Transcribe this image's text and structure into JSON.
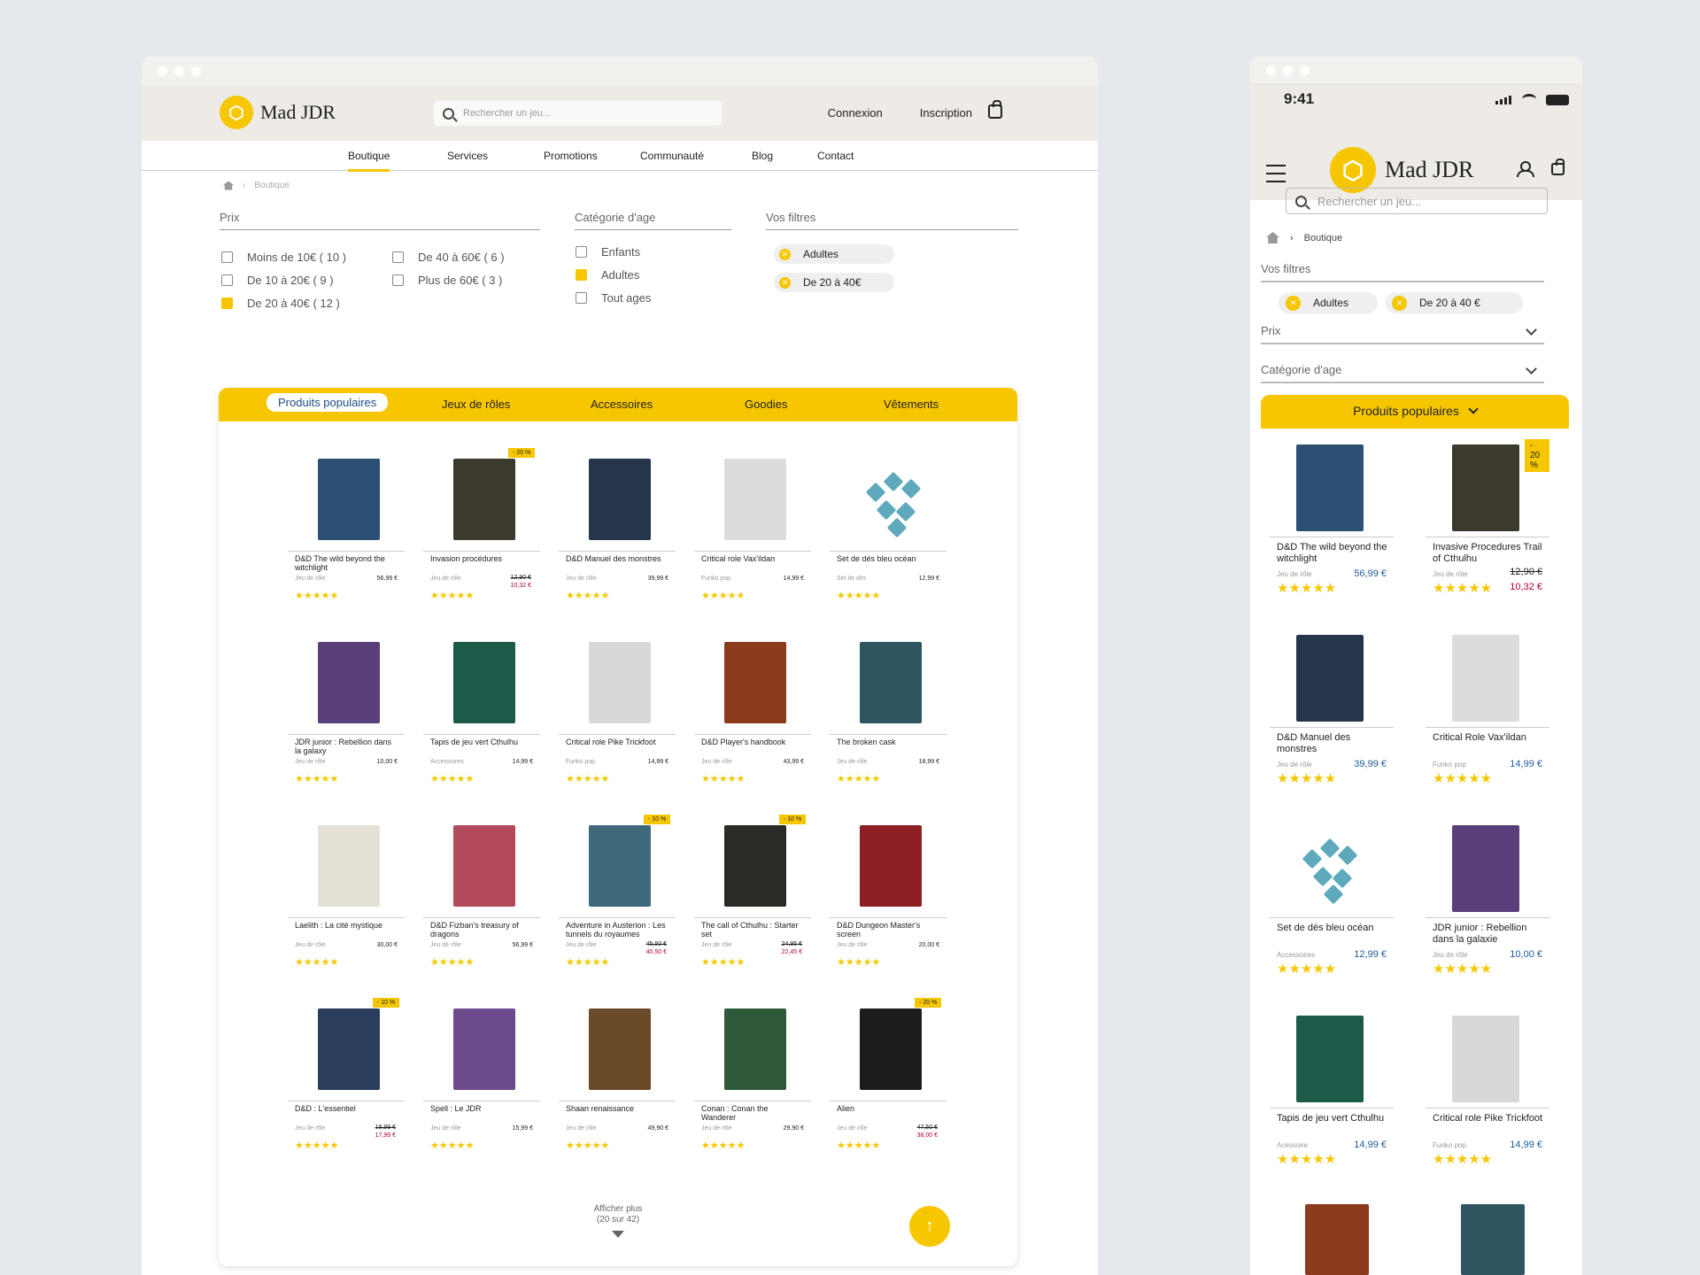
{
  "brand": {
    "name": "Mad JDR",
    "accent": "#f6c700",
    "price_color": "#1f5a9a",
    "sale_color": "#b0002a"
  },
  "desktop": {
    "search_placeholder": "Rechercher un jeu...",
    "login": "Connexion",
    "signup": "Inscription",
    "nav": [
      "Boutique",
      "Services",
      "Promotions",
      "Communauté",
      "Blog",
      "Contact"
    ],
    "breadcrumb": "Boutique",
    "filters": {
      "price_title": "Prix",
      "price_options": [
        "Moins de 10€ ( 10 )",
        "De 10 à 20€ ( 9 )",
        "De 20 à 40€ ( 12 )",
        "De 40 à 60€ ( 6 )",
        "Plus de 60€ ( 3 )"
      ],
      "age_title": "Catégorie d'age",
      "age_options": [
        "Enfants",
        "Adultes",
        "Tout ages"
      ],
      "active_title": "Vos filtres",
      "active": [
        "Adultes",
        "De 20 à 40€"
      ]
    },
    "tabs": [
      "Produits populaires",
      "Jeux de rôles",
      "Accessoires",
      "Goodies",
      "Vêtements"
    ],
    "products": [
      {
        "name": "D&D The wild beyond the witchlight",
        "cat": "Jeu de rôle",
        "price": "56,99 €",
        "color": "#2d4f74"
      },
      {
        "name": "Invasion procédures",
        "cat": "Jeu de rôle",
        "old": "12,90 €",
        "new": "10,32 €",
        "badge": "- 20 %",
        "color": "#3b3a2c"
      },
      {
        "name": "D&D Manuel des monstres",
        "cat": "Jeu de rôle",
        "price": "39,99 €",
        "color": "#25364a"
      },
      {
        "name": "Critical role Vax'ildan",
        "cat": "Funko pop",
        "price": "14,99 €",
        "color": "#dcdcdc"
      },
      {
        "name": "Set de dés bleu océan",
        "cat": "Set de dés",
        "price": "12,99 €",
        "color": "dice"
      },
      {
        "name": "JDR junior : Rebellion dans la galaxy",
        "cat": "Jeu de rôle",
        "price": "10,00 €",
        "color": "#5b3f7a"
      },
      {
        "name": "Tapis de jeu vert Cthulhu",
        "cat": "Accessoires",
        "price": "14,99 €",
        "color": "#1e5a4a"
      },
      {
        "name": "Critical role Pike Trickfoot",
        "cat": "Funko pop",
        "price": "14,99 €",
        "color": "#d8d8d8"
      },
      {
        "name": "D&D Player's handbook",
        "cat": "Jeu de rôle",
        "price": "43,99 €",
        "color": "#8b3a1c"
      },
      {
        "name": "The broken cask",
        "cat": "Jeu de rôle",
        "price": "18,99 €",
        "color": "#2f5660"
      },
      {
        "name": "Laelith : La cité mystique",
        "cat": "Jeu de rôle",
        "price": "30,00 €",
        "color": "#e4e0d6"
      },
      {
        "name": "D&D Fizban's treasury of dragons",
        "cat": "Jeu de rôle",
        "price": "56,99 €",
        "color": "#b24a5c"
      },
      {
        "name": "Adventure in Austerion : Les tunnels du royaumes",
        "cat": "Jeu de rôle",
        "old": "45,50 €",
        "new": "40,50 €",
        "badge": "- 10 %",
        "color": "#3f6a7c"
      },
      {
        "name": "The call of Cthulhu : Starter set",
        "cat": "Jeu de rôle",
        "old": "24,95 €",
        "new": "22,45 €",
        "badge": "- 10 %",
        "color": "#2a2a26"
      },
      {
        "name": "D&D Dungeon Master's screen",
        "cat": "Jeu de rôle",
        "price": "20,00 €",
        "color": "#8e1f24"
      },
      {
        "name": "D&D : L'essentiel",
        "cat": "Jeu de rôle",
        "old": "19,99 €",
        "new": "17,99 €",
        "badge": "- 10 %",
        "color": "#2a3d5c"
      },
      {
        "name": "Spell : Le JDR",
        "cat": "Jeu de rôle",
        "price": "15,99 €",
        "color": "#6c4a8c"
      },
      {
        "name": "Shaan renaissance",
        "cat": "Jeu de rôle",
        "price": "49,90 €",
        "color": "#6b4a2a"
      },
      {
        "name": "Conan : Conan the Wanderer",
        "cat": "Jeu de rôle",
        "price": "29,90 €",
        "color": "#2e5a3a"
      },
      {
        "name": "Alien",
        "cat": "Jeu de rôle",
        "old": "47,50 €",
        "new": "38,00 €",
        "badge": "- 20 %",
        "color": "#1c1c1c"
      }
    ],
    "more_label": "Afficher plus",
    "more_count": "(20 sur 42)"
  },
  "mobile": {
    "time": "9:41",
    "search_placeholder": "Rechercher un jeu...",
    "breadcrumb": "Boutique",
    "active_title": "Vos filtres",
    "active": [
      "Adultes",
      "De 20 à 40 €"
    ],
    "price_title": "Prix",
    "age_title": "Catégorie d'age",
    "tab": "Produits populaires",
    "products": [
      {
        "name": "D&D The wild beyond the witchlight",
        "cat": "Jeu de rôle",
        "price": "56,99 €",
        "color": "#2d4f74"
      },
      {
        "name": "Invasive Procedures Trail of Cthulhu",
        "cat": "Jeu de rôle",
        "old": "12,90 €",
        "new": "10,32 €",
        "badge": "- 20 %",
        "color": "#3b3a2c"
      },
      {
        "name": "D&D Manuel des monstres",
        "cat": "Jeu de rôle",
        "price": "39,99 €",
        "color": "#25364a"
      },
      {
        "name": "Critical Role Vax'ildan",
        "cat": "Funko pop",
        "price": "14,99 €",
        "color": "#dcdcdc"
      },
      {
        "name": "Set de dés bleu océan",
        "cat": "Accessoires",
        "price": "12,99 €",
        "color": "dice"
      },
      {
        "name": "JDR junior : Rebellion dans la galaxie",
        "cat": "Jeu de rôle",
        "price": "10,00 €",
        "color": "#5b3f7a"
      },
      {
        "name": "Tapis de jeu vert Cthulhu",
        "cat": "Acessoire",
        "price": "14,99 €",
        "color": "#1e5a4a"
      },
      {
        "name": "Critical role Pike Trickfoot",
        "cat": "Funko pop",
        "price": "14,99 €",
        "color": "#d8d8d8"
      }
    ],
    "peek": [
      "#8b3a1c",
      "#2f5660"
    ]
  }
}
